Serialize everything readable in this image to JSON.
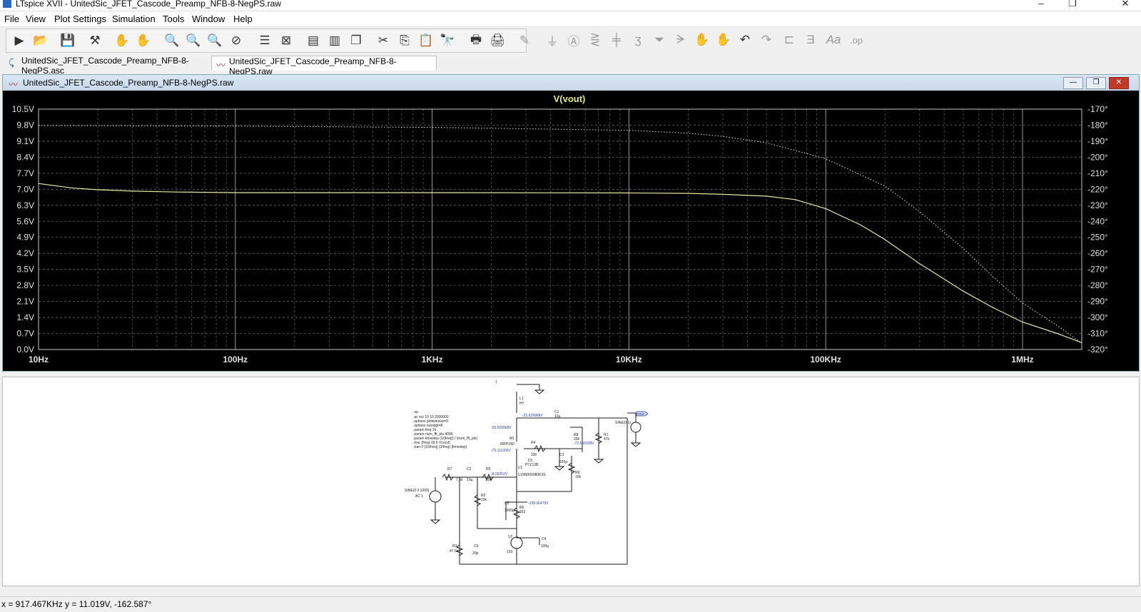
{
  "app": {
    "window_title": "LTspice XVII - UnitedSic_JFET_Cascode_Preamp_NFB-8-NegPS.raw",
    "window_controls": {
      "minimize": "–",
      "restore": "❐",
      "close": "✕"
    }
  },
  "menu": [
    "File",
    "View",
    "Plot Settings",
    "Simulation",
    "Tools",
    "Window",
    "Help"
  ],
  "toolbar": {
    "icons": [
      "run-icon",
      "open-icon",
      "save-icon",
      "control-panel-icon",
      "halt-icon",
      "pan-icon",
      "zoom-in-icon",
      "zoom-full-icon",
      "zoom-out-icon",
      "zoom-cancel-icon",
      "autorange-icon",
      "measure-icon",
      "tile-horizontal-icon",
      "tile-vertical-icon",
      "cascade-icon",
      "cut-icon",
      "copy-icon",
      "paste-icon",
      "find-icon",
      "print-setup-icon",
      "print-icon",
      "wire-icon",
      "ground-icon",
      "label-net-icon",
      "resistor-icon",
      "capacitor-icon",
      "inductor-icon",
      "diode-icon",
      "component-icon",
      "move-icon",
      "drag-icon",
      "undo-icon",
      "redo-icon",
      "rotate-icon",
      "mirror-icon",
      "text-icon",
      "spice-directive-icon"
    ]
  },
  "tabs": [
    {
      "label": "UnitedSic_JFET_Cascode_Preamp_NFB-8-NegPS.asc",
      "icon": "schematic-icon",
      "active": false
    },
    {
      "label": "UnitedSic_JFET_Cascode_Preamp_NFB-8-NegPS.raw",
      "icon": "waveform-icon",
      "active": true
    }
  ],
  "plot_window": {
    "title": "UnitedSic_JFET_Cascode_Preamp_NFB-8-NegPS.raw",
    "buttons": {
      "minimize": "—",
      "restore": "❐",
      "close": "✕"
    }
  },
  "chart_data": {
    "type": "line",
    "title": "V(vout)",
    "x_scale": "log",
    "xlim": [
      10,
      2000000
    ],
    "x_ticks": [
      {
        "value": 10,
        "label": "10Hz"
      },
      {
        "value": 100,
        "label": "100Hz"
      },
      {
        "value": 1000,
        "label": "1KHz"
      },
      {
        "value": 10000,
        "label": "10KHz"
      },
      {
        "value": 100000,
        "label": "100KHz"
      },
      {
        "value": 1000000,
        "label": "1MHz"
      }
    ],
    "y_left": {
      "lim": [
        0,
        10.5
      ],
      "labels": [
        "10.5V",
        "9.8V",
        "9.1V",
        "8.4V",
        "7.7V",
        "7.0V",
        "6.3V",
        "5.6V",
        "4.9V",
        "4.2V",
        "3.5V",
        "2.8V",
        "2.1V",
        "1.4V",
        "0.7V",
        "0.0V"
      ]
    },
    "y_right": {
      "lim": [
        -320,
        -170
      ],
      "labels": [
        "-170°",
        "-180°",
        "-190°",
        "-200°",
        "-210°",
        "-220°",
        "-230°",
        "-240°",
        "-250°",
        "-260°",
        "-270°",
        "-280°",
        "-290°",
        "-300°",
        "-310°",
        "-320°"
      ]
    },
    "grid": true,
    "series": [
      {
        "type": "magnitude",
        "axis": "left",
        "color": "#e8e8a0",
        "x": [
          10,
          15,
          20,
          30,
          50,
          100,
          1000,
          10000,
          20000,
          30000,
          50000,
          70000,
          100000,
          150000,
          200000,
          300000,
          500000,
          700000,
          1000000,
          1500000,
          2000000
        ],
        "y": [
          7.25,
          7.05,
          6.98,
          6.92,
          6.88,
          6.85,
          6.85,
          6.84,
          6.82,
          6.78,
          6.7,
          6.55,
          6.15,
          5.45,
          4.8,
          3.75,
          2.55,
          1.85,
          1.2,
          0.7,
          0.3
        ]
      },
      {
        "type": "phase",
        "axis": "right",
        "color": "#e8e8e8",
        "x": [
          10,
          100,
          1000,
          10000,
          20000,
          30000,
          50000,
          100000,
          200000,
          300000,
          500000,
          700000,
          1000000,
          1500000,
          2000000
        ],
        "y": [
          -180.2,
          -180.6,
          -181.4,
          -183.2,
          -185.0,
          -187.0,
          -191.0,
          -201.0,
          -218.0,
          -234.0,
          -257.0,
          -274.0,
          -291.0,
          -305.0,
          -316.0
        ]
      }
    ]
  },
  "schematic": {
    "directives": [
      ".op",
      ".ac oct 10 10 2000000",
      ".options plotwinsize=0",
      ".options numdgt=8",
      ".param freq 1k",
      ".param num_fft_pts 4096",
      ".param timestep (1/{freq}) / (num_fft_pts)",
      ".four {freq} 19 6 V(vout)",
      ".tran 0 {15/freq} {3/freq} {timestep}"
    ],
    "components": [
      {
        "ref": "L1",
        "value": "H7"
      },
      {
        "ref": "C1",
        "value": "10µ"
      },
      {
        "ref": "M1",
        "value": "IRFP240"
      },
      {
        "ref": "R4",
        "value": "330"
      },
      {
        "ref": "D1",
        "value": "PTZ12B"
      },
      {
        "ref": "R8",
        "value": "20k"
      },
      {
        "ref": "C3",
        "value": "220µ"
      },
      {
        "ref": "R1",
        "value": "47k"
      },
      {
        "ref": "R9",
        "value": "10k"
      },
      {
        "ref": "U1",
        "value": "UJ3N065080K3S"
      },
      {
        "ref": "R7",
        "value": "7.5k"
      },
      {
        "ref": "C2",
        "value": "10µ"
      },
      {
        "ref": "R5",
        "value": "200"
      },
      {
        "ref": "R2",
        "value": "10k"
      },
      {
        "ref": "C5",
        "value": "1000µ"
      },
      {
        "ref": "R6",
        "value": "163"
      },
      {
        "ref": "V2",
        "value": "120"
      },
      {
        "ref": "C4",
        "value": "100µ"
      },
      {
        "ref": "R3",
        "value": "47.5k"
      },
      {
        "ref": "C6",
        "value": "20p"
      },
      {
        "ref": "I1",
        "value": "SINE(0 1)"
      }
    ],
    "source_v1": [
      "SINE(0 0 1000)",
      "AC 1"
    ],
    "probe_labels": [
      "-25.629968V",
      "-25.629968V",
      "-75.111005V",
      "-72.650028V",
      "-8.03252V",
      "-108.06479V"
    ],
    "net_label": "vout",
    "sheet_marker": "1"
  },
  "status_bar": {
    "text": "x = 917.467KHz   y = 11.019V, -162.587°"
  }
}
